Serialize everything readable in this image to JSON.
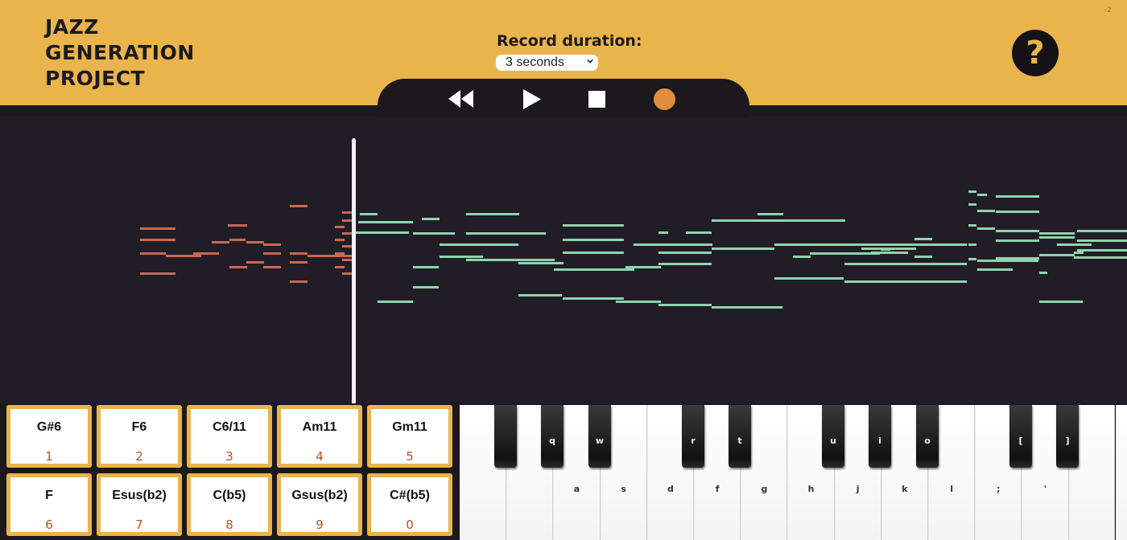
{
  "app": {
    "title_lines": [
      "JAZZ",
      "GENERATION",
      "PROJECT"
    ],
    "corner_mark": "-2"
  },
  "record": {
    "label": "Record duration:",
    "selected": "3 seconds"
  },
  "help": {
    "label": "?"
  },
  "transport": {
    "buttons": [
      "rewind-icon",
      "play-icon",
      "stop-icon",
      "record-icon"
    ],
    "colors": {
      "icons": "#ffffff",
      "record": "#e08d3c"
    }
  },
  "colors": {
    "accent": "#eab44c",
    "background": "#211d27",
    "input_notes": "#c8694f",
    "generated_notes": "#8fd4ac",
    "playhead": "#f2f2f2"
  },
  "chords": [
    {
      "name": "G#6",
      "key": "1"
    },
    {
      "name": "F6",
      "key": "2"
    },
    {
      "name": "C6/11",
      "key": "3"
    },
    {
      "name": "Am11",
      "key": "4"
    },
    {
      "name": "Gm11",
      "key": "5"
    },
    {
      "name": "F",
      "key": "6"
    },
    {
      "name": "Esus(b2)",
      "key": "7"
    },
    {
      "name": "C(b5)",
      "key": "8"
    },
    {
      "name": "Gsus(b2)",
      "key": "9"
    },
    {
      "name": "C#(b5)",
      "key": "0"
    }
  ],
  "keyboard": {
    "white_keys": [
      "",
      "",
      "a",
      "s",
      "d",
      "f",
      "g",
      "h",
      "j",
      "k",
      "l",
      ";",
      "'",
      "",
      ""
    ],
    "black_keys": [
      "",
      "q",
      "w",
      "r",
      "t",
      "u",
      "i",
      "o",
      "[",
      "]"
    ]
  }
}
